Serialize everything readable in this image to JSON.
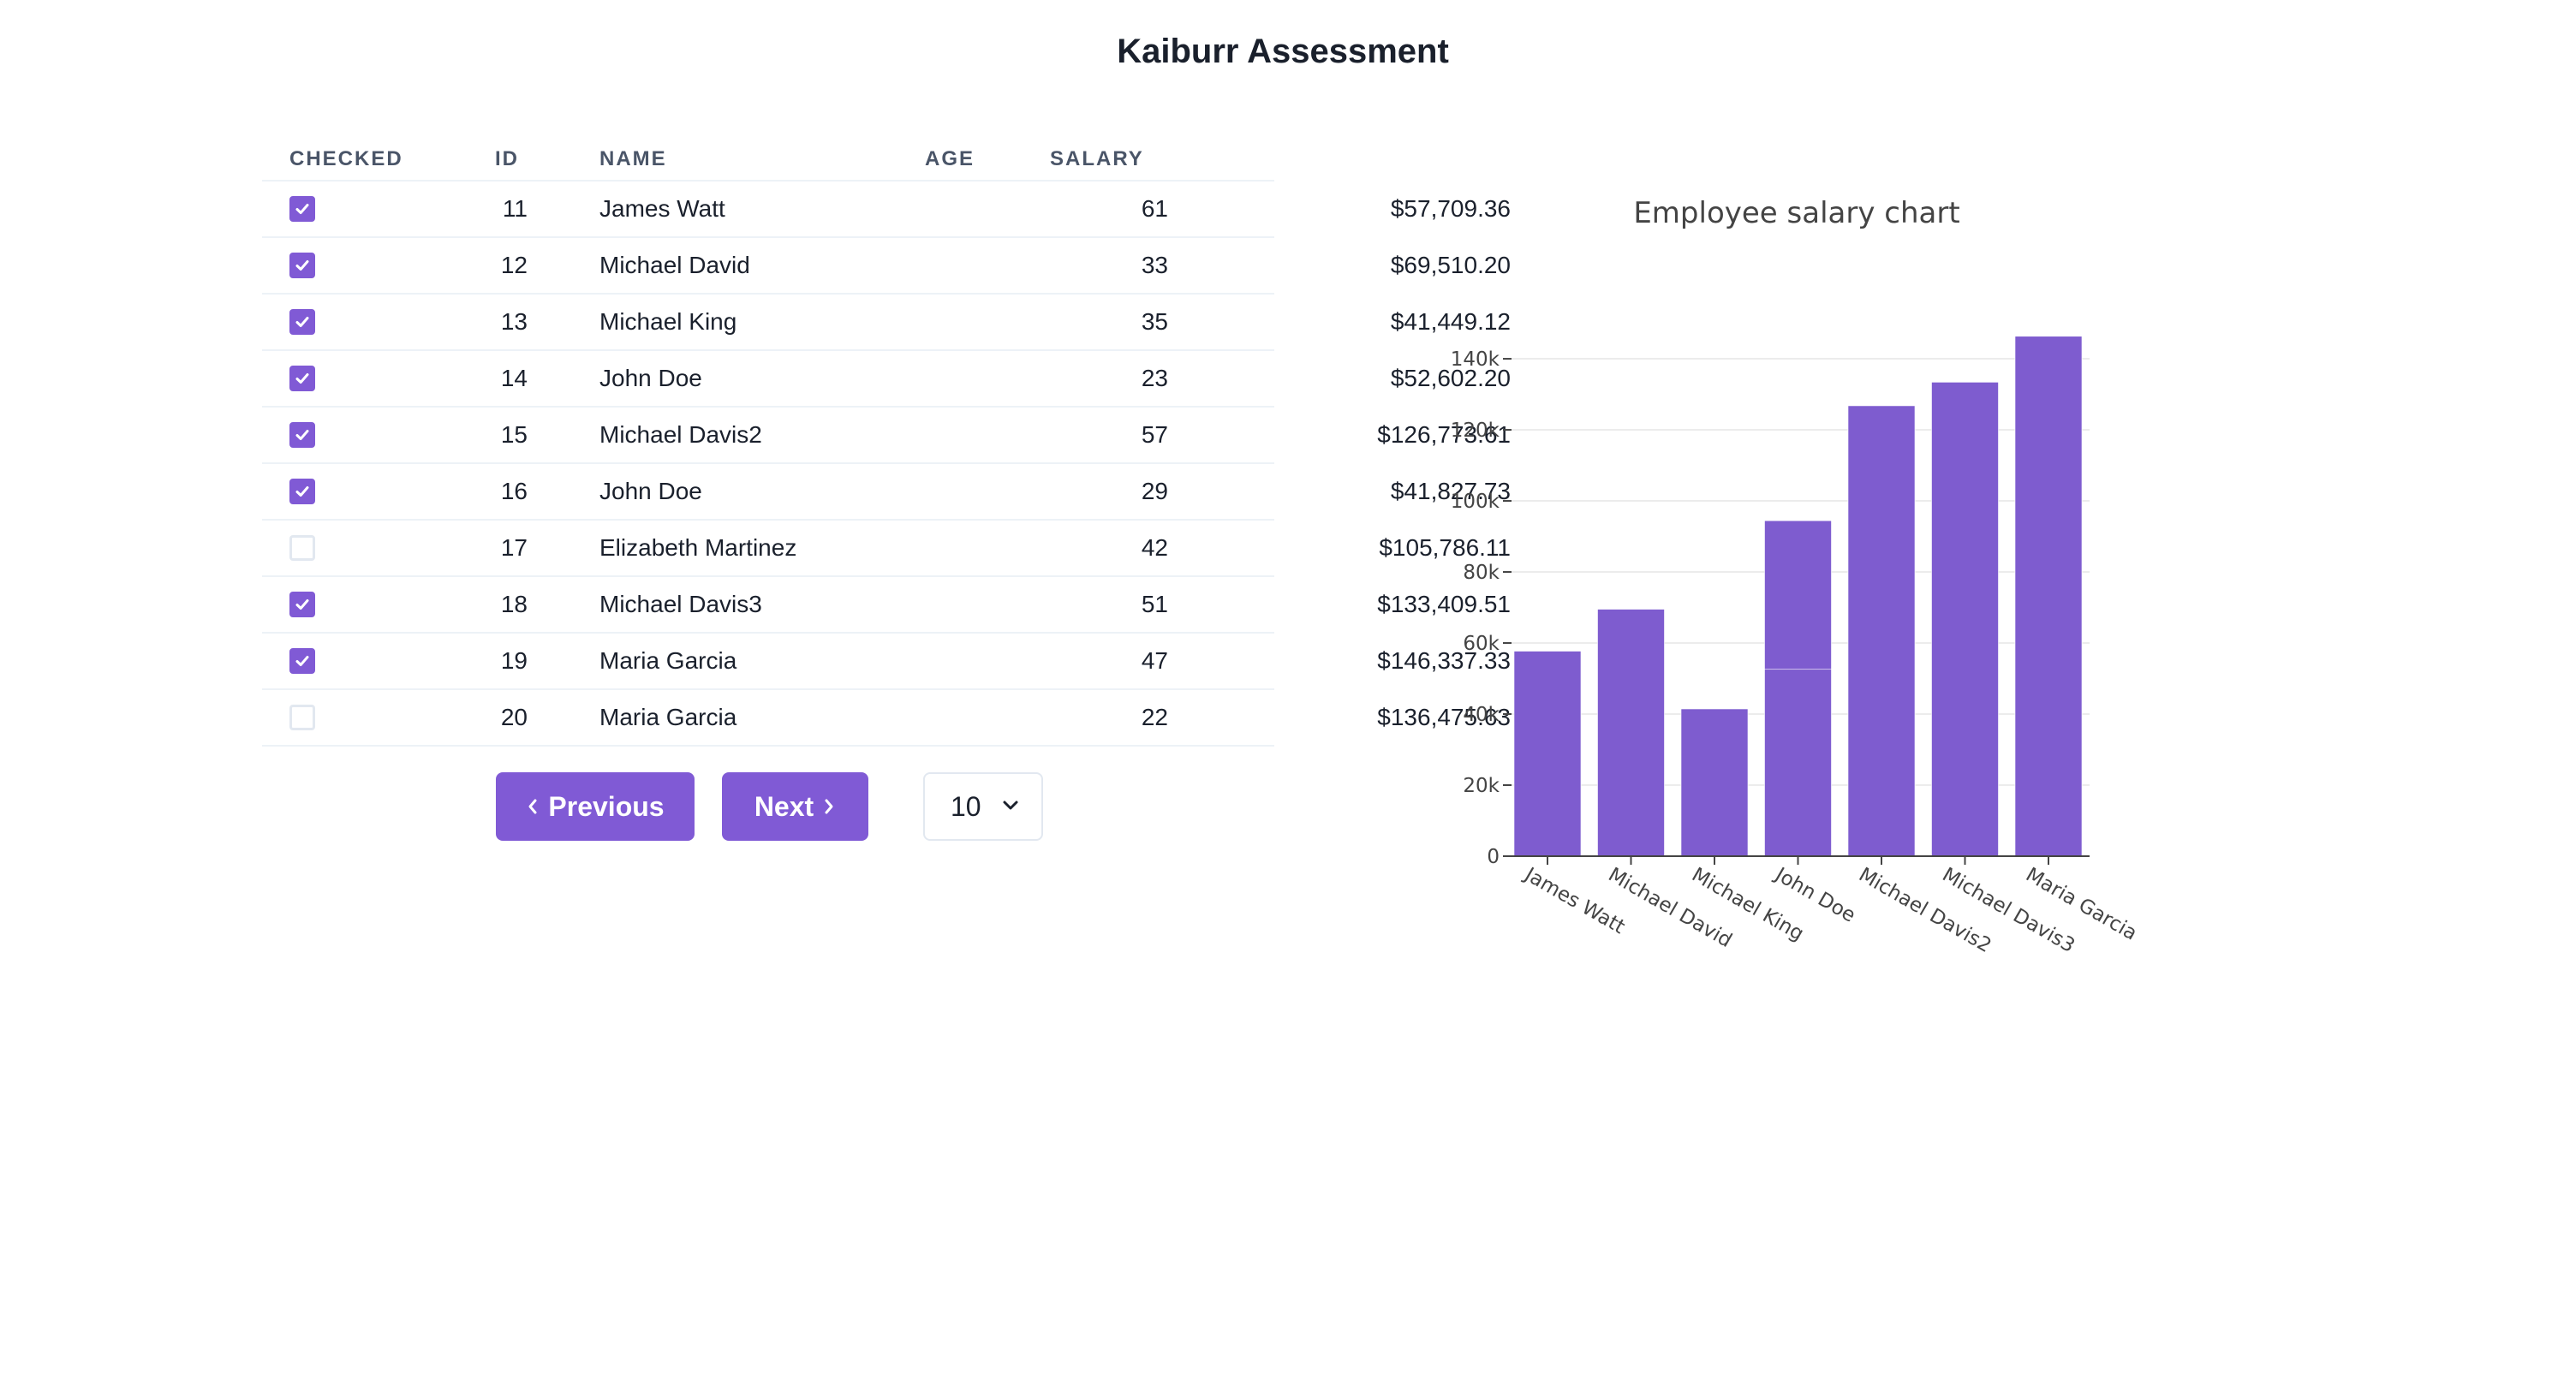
{
  "page": {
    "title": "Kaiburr Assessment"
  },
  "table": {
    "columns": [
      "CHECKED",
      "ID",
      "NAME",
      "AGE",
      "SALARY"
    ],
    "rows": [
      {
        "checked": true,
        "id": "11",
        "name": "James Watt",
        "age": "61",
        "salary": "$57,709.36"
      },
      {
        "checked": true,
        "id": "12",
        "name": "Michael David",
        "age": "33",
        "salary": "$69,510.20"
      },
      {
        "checked": true,
        "id": "13",
        "name": "Michael King",
        "age": "35",
        "salary": "$41,449.12"
      },
      {
        "checked": true,
        "id": "14",
        "name": "John Doe",
        "age": "23",
        "salary": "$52,602.20"
      },
      {
        "checked": true,
        "id": "15",
        "name": "Michael Davis2",
        "age": "57",
        "salary": "$126,773.61"
      },
      {
        "checked": true,
        "id": "16",
        "name": "John Doe",
        "age": "29",
        "salary": "$41,827.73"
      },
      {
        "checked": false,
        "id": "17",
        "name": "Elizabeth Martinez",
        "age": "42",
        "salary": "$105,786.11"
      },
      {
        "checked": true,
        "id": "18",
        "name": "Michael Davis3",
        "age": "51",
        "salary": "$133,409.51"
      },
      {
        "checked": true,
        "id": "19",
        "name": "Maria Garcia",
        "age": "47",
        "salary": "$146,337.33"
      },
      {
        "checked": false,
        "id": "20",
        "name": "Maria Garcia",
        "age": "22",
        "salary": "$136,475.63"
      }
    ]
  },
  "pagination": {
    "prev_label": "Previous",
    "next_label": "Next",
    "page_size": "10"
  },
  "colors": {
    "accent": "#805ad5",
    "bar": "#7e5ccf",
    "border": "#edf2f7"
  },
  "icons": {
    "check": "checkmark-icon",
    "prev": "chevron-left-icon",
    "next": "chevron-right-icon",
    "select": "chevron-down-icon"
  },
  "chart_data": {
    "type": "bar",
    "title": "Employee salary chart",
    "stacked": true,
    "categories": [
      "James Watt",
      "Michael David",
      "Michael King",
      "John Doe",
      "Michael Davis2",
      "Michael Davis3",
      "Maria Garcia"
    ],
    "segments": [
      [
        57709.36
      ],
      [
        69510.2
      ],
      [
        41449.12
      ],
      [
        52602.2,
        41827.73
      ],
      [
        126773.61
      ],
      [
        133409.51
      ],
      [
        146337.33
      ]
    ],
    "values": [
      57709.36,
      69510.2,
      41449.12,
      94429.93,
      126773.61,
      133409.51,
      146337.33
    ],
    "ylim": [
      0,
      147000
    ],
    "yticks": [
      0,
      20000,
      40000,
      60000,
      80000,
      100000,
      120000,
      140000
    ],
    "ytick_labels": [
      "0",
      "20k",
      "40k",
      "60k",
      "80k",
      "100k",
      "120k",
      "140k"
    ],
    "grid": true,
    "xlabel": "",
    "ylabel": ""
  }
}
